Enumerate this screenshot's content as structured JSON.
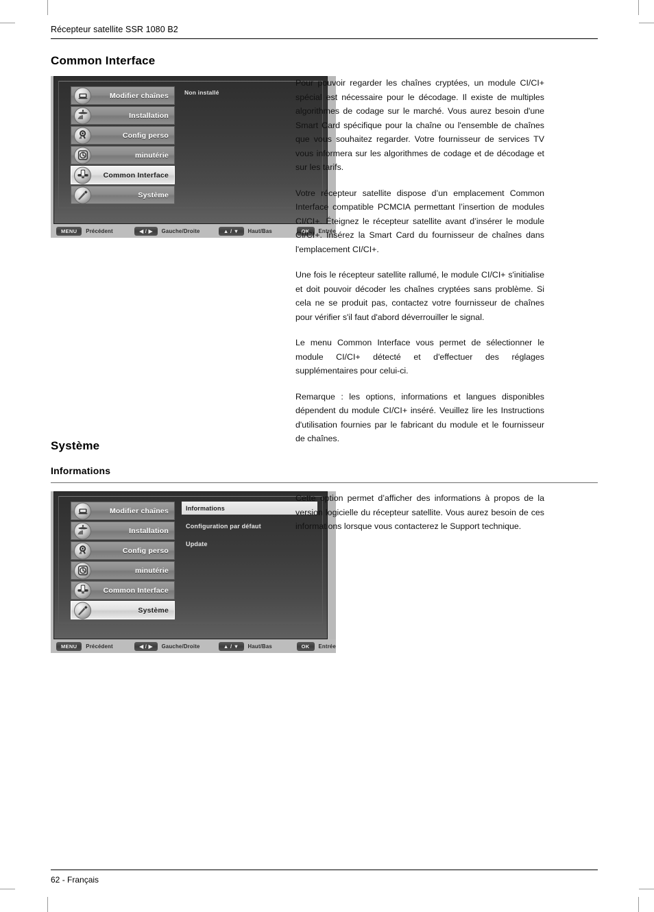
{
  "header": {
    "running_head": "Récepteur satellite SSR 1080 B2"
  },
  "sections": {
    "common_interface": {
      "title": "Common Interface",
      "paragraphs": [
        "Pour pouvoir regarder les chaînes cryptées, un module CI/CI+ spécial est nécessaire pour le décodage. Il existe de multiples algorithmes de codage sur le marché. Vous aurez besoin d'une Smart Card spécifique pour la chaîne ou l'ensemble de chaînes que vous souhaitez regarder. Votre fournisseur de services TV vous informera sur les algorithmes de codage et de décodage et sur les tarifs.",
        "Votre récepteur satellite dispose d’un emplacement Common Interface compatible PCMCIA permettant l’insertion de modules CI/CI+. Éteignez le récepteur satellite avant d’insérer le module CI/CI+. Insérez la Smart Card du fournisseur de chaînes dans l'emplacement CI/CI+.",
        "Une fois le récepteur satellite rallumé, le module CI/CI+ s'initialise et doit pouvoir décoder les chaînes cryptées sans problème. Si cela ne se produit pas, contactez votre fournisseur de chaînes pour vérifier s'il faut d'abord déverrouiller le signal.",
        "Le menu Common Interface vous permet de sélectionner le module CI/CI+ détecté et d'effectuer des réglages supplémentaires pour celui-ci.",
        "Remarque : les options, informations et langues disponibles dépendent du module CI/CI+ inséré. Veuillez lire les Instructions d'utilisation fournies par le fabricant du module et le fournisseur de chaînes."
      ]
    },
    "systeme": {
      "title": "Système",
      "sub_title": "Informations",
      "paragraphs": [
        "Cette option permet d’afficher des informations à propos de la version logicielle du récepteur satellite. Vous aurez besoin de ces informations lorsque vous contacterez le Support technique."
      ]
    }
  },
  "osd_menu": {
    "items": [
      {
        "label": "Modifier chaînes",
        "icon": "tv-screen-icon"
      },
      {
        "label": "Installation",
        "icon": "satellite-dish-icon"
      },
      {
        "label": "Config perso",
        "icon": "user-settings-icon"
      },
      {
        "label": "minutérie",
        "icon": "clock-timer-icon"
      },
      {
        "label": "Common Interface",
        "icon": "card-slot-icon"
      },
      {
        "label": "Système",
        "icon": "tools-icon"
      }
    ],
    "keybar": [
      {
        "key": "MENU",
        "action": "Précédent"
      },
      {
        "key": "◀ / ▶",
        "action": "Gauche/Droite"
      },
      {
        "key": "▲ / ▼",
        "action": "Haut/Bas"
      },
      {
        "key": "OK",
        "action": "Entrée"
      }
    ]
  },
  "screenshot_ci": {
    "selected_index": 4,
    "detail_note": "Non installé"
  },
  "screenshot_systeme": {
    "selected_index": 5,
    "submenu": [
      {
        "label": "Informations",
        "selected": true
      },
      {
        "label": "Configuration par défaut",
        "selected": false
      },
      {
        "label": "Update",
        "selected": false
      }
    ]
  },
  "footer": {
    "page_number": "62",
    "separator": "-",
    "language": "Français"
  }
}
